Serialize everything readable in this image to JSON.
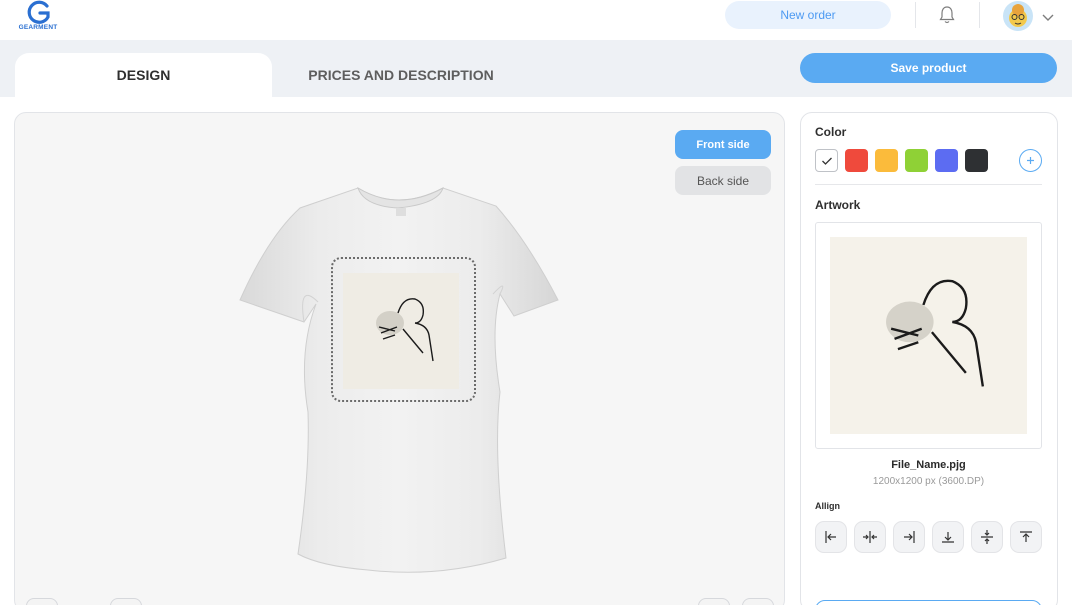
{
  "header": {
    "logo_text": "GEARMENT",
    "new_order_label": "New order",
    "icons": [
      "gearment-logo",
      "bell-icon",
      "avatar",
      "chevron-down-icon"
    ]
  },
  "tabs": [
    {
      "label": "DESIGN",
      "active": true
    },
    {
      "label": "PRICES AND DESCRIPTION",
      "active": false
    }
  ],
  "save_label": "Save product",
  "canvas": {
    "front_label": "Front side",
    "back_label": "Back side",
    "active_side": "front"
  },
  "panel": {
    "color_label": "Color",
    "colors": [
      {
        "name": "white",
        "hex": "#ffffff",
        "selected": true
      },
      {
        "name": "red",
        "hex": "#ef4a3c"
      },
      {
        "name": "yellow",
        "hex": "#fbbb3b"
      },
      {
        "name": "green",
        "hex": "#8fd136"
      },
      {
        "name": "blue",
        "hex": "#5c6cf2"
      },
      {
        "name": "black",
        "hex": "#2e3033"
      }
    ],
    "artwork_label": "Artwork",
    "file_name": "File_Name.pjg",
    "file_dims": "1200x1200 px (3600.DP)",
    "align_label": "Allign",
    "align_icons": [
      "align-left-icon",
      "align-center-horizontal-icon",
      "align-right-icon",
      "align-bottom-icon",
      "align-center-vertical-icon",
      "align-top-icon"
    ]
  },
  "accent_color": "#5aaaf2"
}
